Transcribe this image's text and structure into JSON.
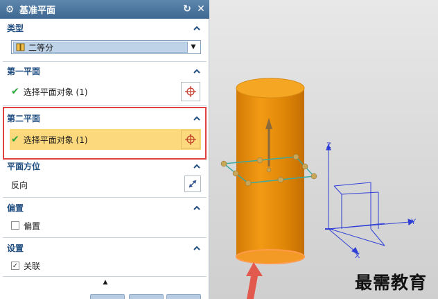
{
  "dialog": {
    "title": "基准平面",
    "gear_icon": "gear-icon",
    "reset_icon": "reset-icon",
    "close_icon": "close-icon"
  },
  "sections": {
    "type": {
      "label": "类型",
      "dropdown_value": "二等分"
    },
    "first_plane": {
      "label": "第一平面",
      "select_text": "选择平面对象 (1)"
    },
    "second_plane": {
      "label": "第二平面",
      "select_text": "选择平面对象 (1)"
    },
    "orientation": {
      "label": "平面方位",
      "reverse_label": "反向"
    },
    "offset": {
      "label": "偏置",
      "checkbox_label": "偏置",
      "checked": false
    },
    "settings": {
      "label": "设置",
      "checkbox_label": "关联",
      "checked": true
    }
  },
  "viewport": {
    "axis_labels": {
      "z": "Z",
      "y": "Y",
      "x": "X"
    },
    "cylinder_color": "#e38b0c",
    "plane_color": "#3aa9a1",
    "arrow_color": "#e25a4d"
  },
  "watermark": "最需教育",
  "colors": {
    "title_bar": "#4a7199",
    "section_label": "#1f4d80",
    "highlight_row": "#fcd97c",
    "highlight_border": "#e04040",
    "check": "#2ba63a"
  }
}
